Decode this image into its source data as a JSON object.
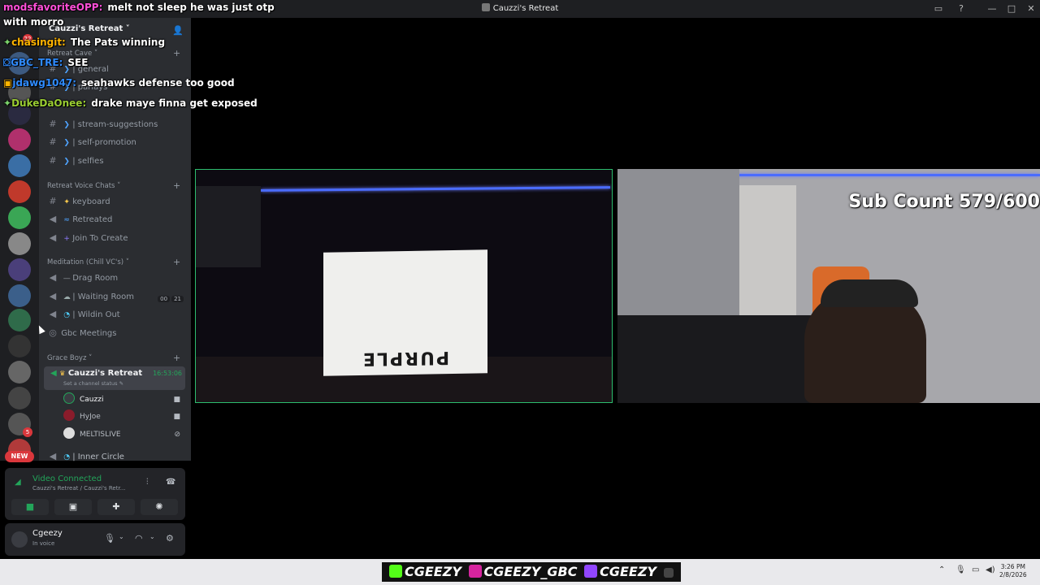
{
  "window": {
    "title": "Cauzzi's Retreat"
  },
  "guild": {
    "name": "Cauzzi's Retreat ˅"
  },
  "categories": {
    "retreat_cave": "Retreat Cave ˅",
    "voice_chats": "Retreat Voice Chats ˅",
    "meditation": "Meditation (Chill VC's) ˅",
    "grace_boyz": "Grace Boyz ˅"
  },
  "channels": {
    "general": "| general",
    "parlays": "| parlays",
    "stream_suggestions": "| stream-suggestions",
    "self_promotion": "| self-promotion",
    "selfies": "| selfies",
    "keyboard": "keyboard",
    "retreated": "Retreated",
    "join_to_create": "Join To Create",
    "drag_room": "Drag Room",
    "waiting_room": "| Waiting Room",
    "waiting_room_count_a": "00",
    "waiting_room_count_b": "21",
    "wildin_out": "| Wildin Out",
    "gbc_meetings": "Gbc Meetings",
    "inner_circle": "| Inner Circle"
  },
  "active_channel": {
    "name": "Cauzzi's Retreat",
    "timer": "16:53:06",
    "status": "Set a channel status ✎",
    "users": [
      "Cauzzi",
      "HyJoe",
      "MELTISLIVE"
    ]
  },
  "voice_panel": {
    "status": "Video Connected",
    "sub": "Cauzzi's Retreat / Cauzzi's Retr..."
  },
  "user_panel": {
    "name": "Cgeezy",
    "status": "In voice"
  },
  "server_rail": {
    "badge1": "22",
    "badge2": "5",
    "new_badge": "NEW"
  },
  "chat": [
    {
      "user": "modsfavoriteOPP:",
      "user_color": "#ff4fd8",
      "msg": "melt not sleep he was just otp"
    },
    {
      "user": "",
      "user_color": "#ffffff",
      "msg": "with morro"
    },
    {
      "user": "chasingit:",
      "user_color": "#ffb400",
      "msg": "The Pats winning"
    },
    {
      "user": "GBC_TRE:",
      "user_color": "#2f8bff",
      "msg": "SEE"
    },
    {
      "user": "jdawg1047:",
      "user_color": "#2f8bff",
      "msg": "seahawks defense too good"
    },
    {
      "user": "DukeDaOnee:",
      "user_color": "#9acd32",
      "msg": "drake maye finna get exposed"
    }
  ],
  "stream": {
    "sub_count": "Sub Count 579/600",
    "bag_text": "PURPLE"
  },
  "taskbar": {
    "handles": [
      "CGEEZY",
      "CGEEZY_GBC",
      "CGEEZY"
    ],
    "time": "3:26 PM",
    "date": "2/8/2026"
  }
}
